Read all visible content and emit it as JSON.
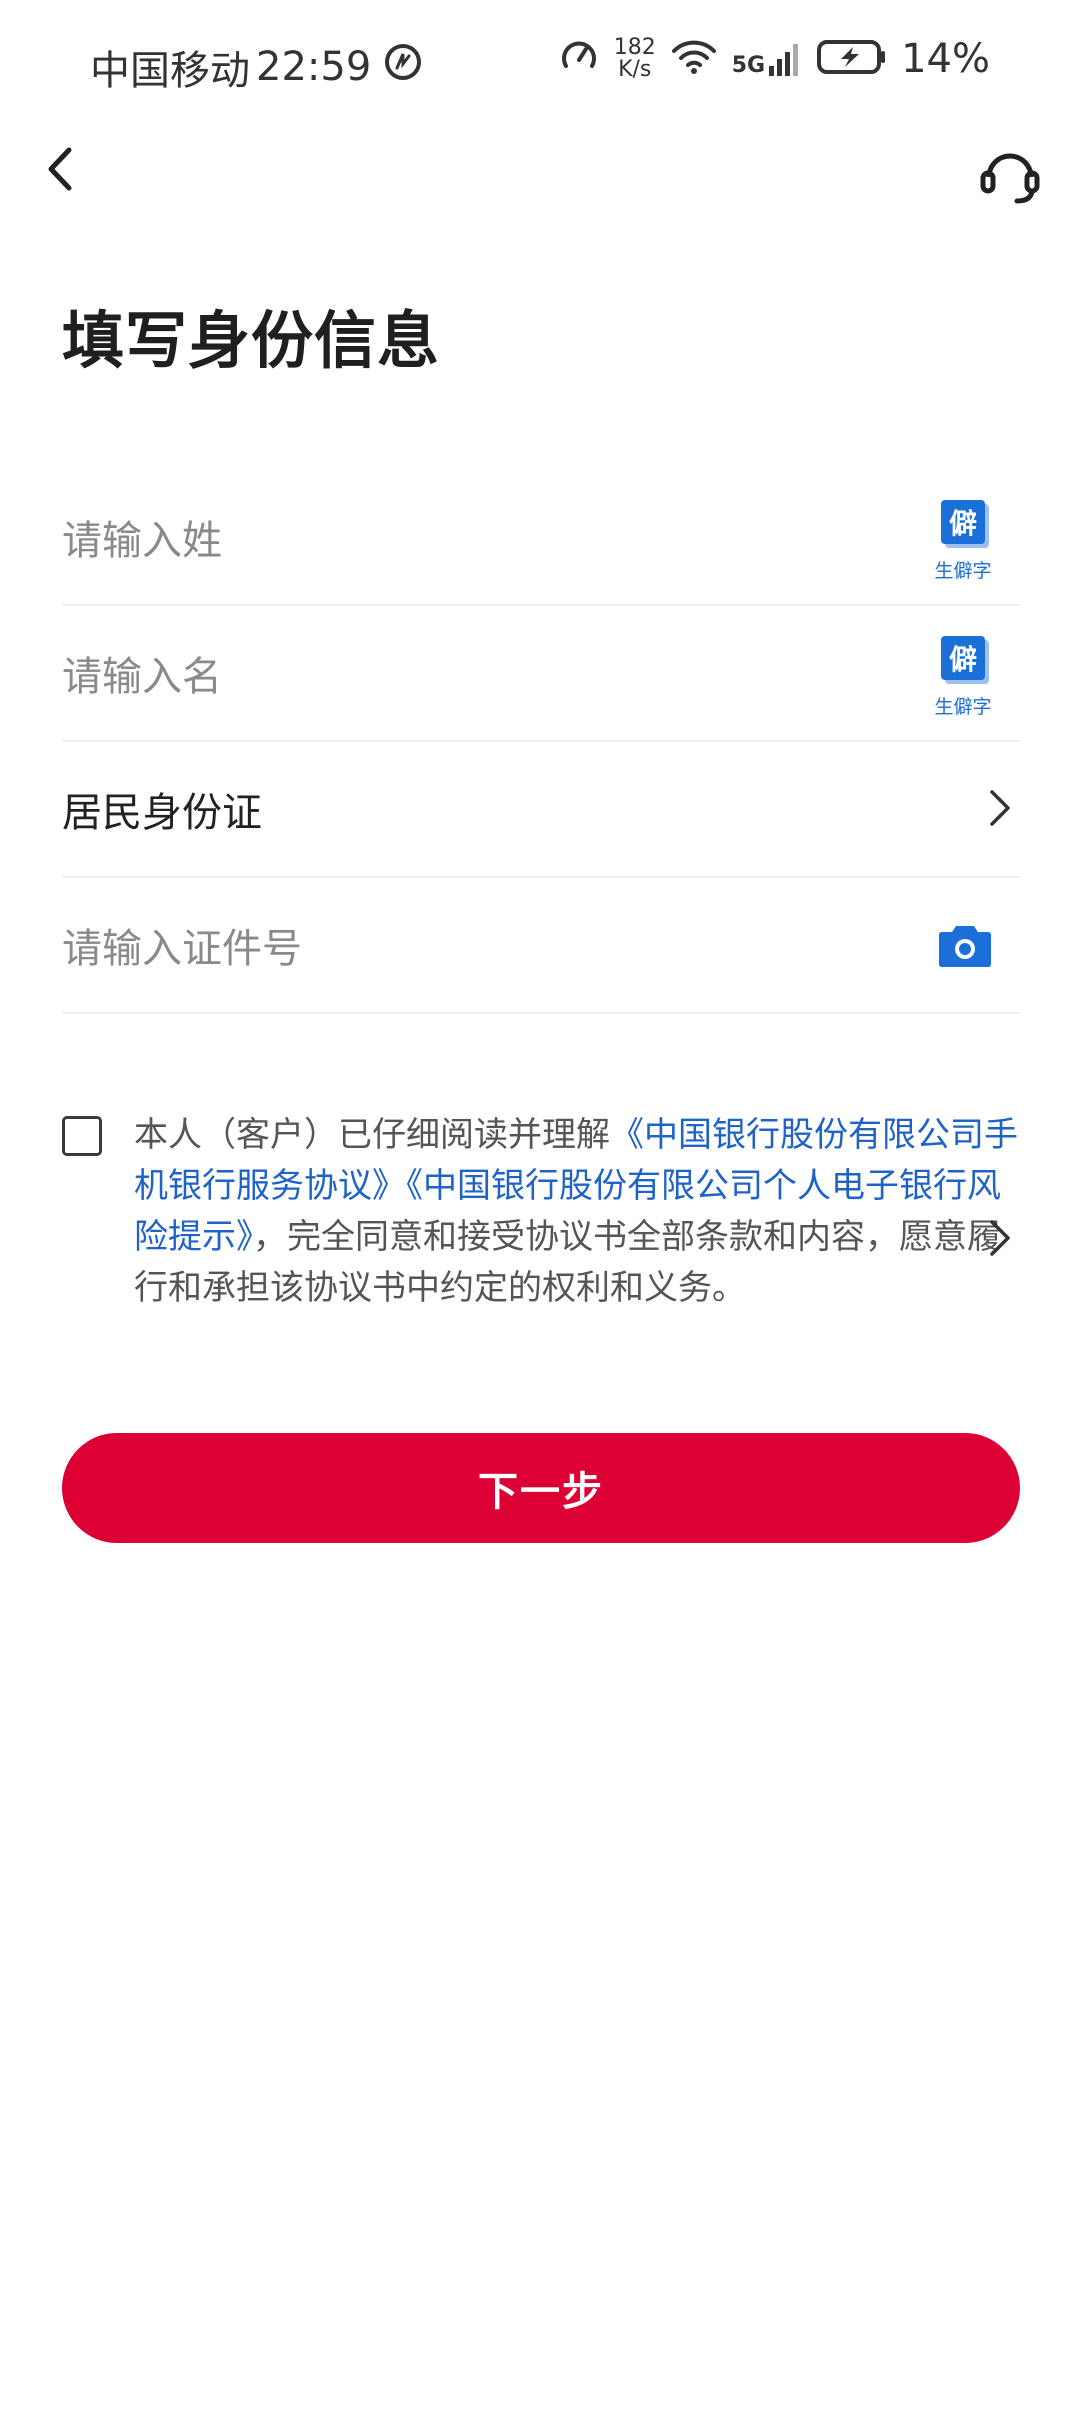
{
  "status_bar": {
    "carrier": "中国移动",
    "time": "22:59",
    "net_speed_value": "182",
    "net_speed_unit": "K/s",
    "network_type": "5G",
    "battery": "14%"
  },
  "header": {
    "title": "填写身份信息"
  },
  "form": {
    "surname_placeholder": "请输入姓",
    "given_name_placeholder": "请输入名",
    "rare_char_label": "生僻字",
    "rare_char_glyph": "僻",
    "id_type_value": "居民身份证",
    "id_number_placeholder": "请输入证件号"
  },
  "agreement": {
    "prefix": "本人（客户）已仔细阅读并理解",
    "link1": "《中国银行股份有限公司手机银行服务协议》",
    "link2": "《中国银行股份有限公司个人电子银行风险提示》",
    "suffix": "，完全同意和接受协议书全部条款和内容，愿意履行和承担该协议书中约定的权利和义务。"
  },
  "actions": {
    "next_label": "下一步"
  },
  "colors": {
    "primary_red": "#dd0034",
    "link_blue": "#1f63c9",
    "icon_blue": "#1b6fd8"
  }
}
